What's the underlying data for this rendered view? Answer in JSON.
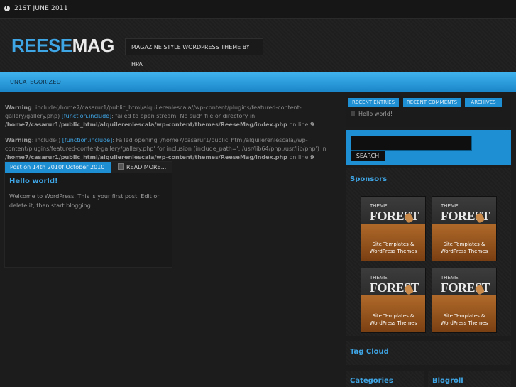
{
  "topbar": {
    "date": "21ST JUNE 2011"
  },
  "header": {
    "logo_part1": "REESE",
    "logo_part2": "MAG",
    "tagline": "MAGAZINE STYLE WORDPRESS THEME BY HPA"
  },
  "nav": {
    "items": [
      {
        "label": "UNCATEGORIZED"
      }
    ]
  },
  "warnings": [
    {
      "label": "Warning",
      "text1": ": include(/home7/casarur1/public_html/alquilerenlescala//wp-content/plugins/featured-content-gallery/gallery.php) ",
      "link": "[function.include]",
      "text2": ": failed to open stream: No such file or directory in ",
      "path": "/home7/casarur1/public_html/alquilerenlescala/wp-content/themes/ReeseMag/index.php",
      "text3": " on line ",
      "line": "9"
    },
    {
      "label": "Warning",
      "text1": ": include() ",
      "link": "[function.include]",
      "text2": ": Failed opening '/home7/casarur1/public_html/alquilerenlescala//wp-content/plugins/featured-content-gallery/gallery.php' for inclusion (include_path='.:/usr/lib64/php:/usr/lib/php') in ",
      "path": "/home7/casarur1/public_html/alquilerenlescala/wp-content/themes/ReeseMag/index.php",
      "text3": " on line ",
      "line": "9"
    }
  ],
  "post": {
    "date": "Post on 14th 2010f October 2010",
    "read_more": "READ MORE...",
    "title": "Hello world!",
    "body": "Welcome to WordPress. This is your first post. Edit or delete it, then start blogging!"
  },
  "sidebar": {
    "tabs": [
      "RECENT ENTRIES",
      "RECENT COMMENTS",
      "ARCHIVES"
    ],
    "entries": [
      "Hello world!"
    ],
    "search": {
      "placeholder": "",
      "button": "SEARCH"
    },
    "sponsors": {
      "title": "Sponsors",
      "ads": [
        {
          "brand_small": "THEME",
          "brand": "FOREST",
          "line1": "Site Templates &",
          "line2": "WordPress Themes"
        },
        {
          "brand_small": "THEME",
          "brand": "FOREST",
          "line1": "Site Templates &",
          "line2": "WordPress Themes"
        },
        {
          "brand_small": "THEME",
          "brand": "FOREST",
          "line1": "Site Templates &",
          "line2": "WordPress Themes"
        },
        {
          "brand_small": "THEME",
          "brand": "FOREST",
          "line1": "Site Templates &",
          "line2": "WordPress Themes"
        }
      ]
    },
    "tag_cloud": {
      "title": "Tag Cloud"
    },
    "categories": {
      "title": "Categories"
    },
    "blogroll": {
      "title": "Blogroll"
    }
  },
  "colors": {
    "accent": "#1f8fd3",
    "link": "#3fa6e6",
    "background": "#1c1c1c"
  }
}
